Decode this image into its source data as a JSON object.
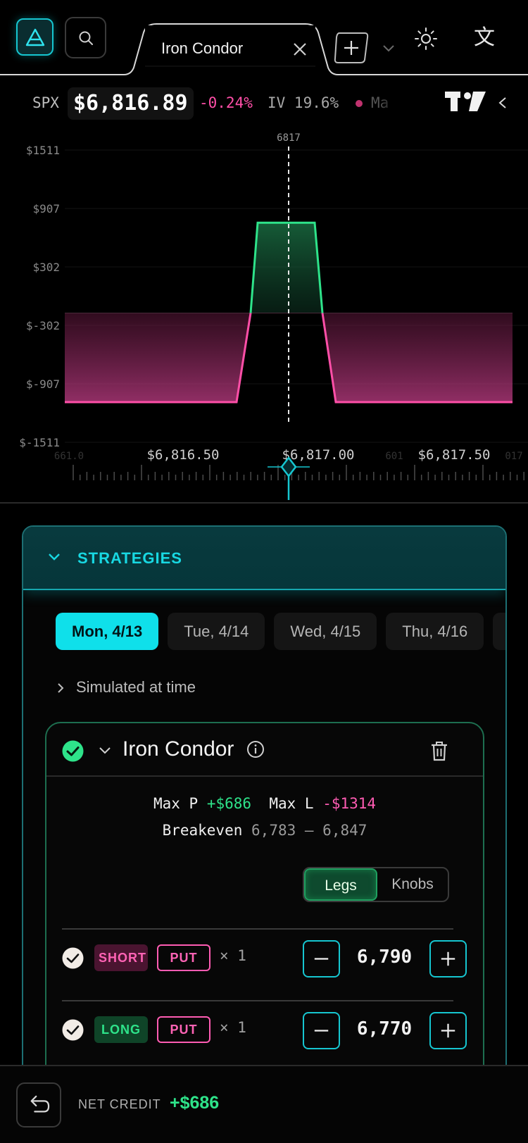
{
  "tab": {
    "title": "Iron Condor"
  },
  "ticker": {
    "symbol": "SPX",
    "price": "$6,816.89",
    "change": "-0.24%",
    "iv": "IV 19.6%",
    "ma": "Ma"
  },
  "chart": {
    "y_ticks": [
      "$1511",
      "$907",
      "$302",
      "$-302",
      "$-907",
      "$-1511"
    ],
    "x_ticks": [
      "$6,816.50",
      "$6,817.00",
      "$6,817.50"
    ],
    "x_faded": [
      "661.0",
      "601",
      "017"
    ],
    "marker_label": "6817"
  },
  "chart_data": {
    "type": "area",
    "title": "",
    "xlabel": "",
    "ylabel": "",
    "x_ticks": [
      "$6,816.50",
      "$6,817.00",
      "$6,817.50"
    ],
    "y_ticks": [
      1511,
      907,
      302,
      -302,
      -907,
      -1511
    ],
    "ylim": [
      -1511,
      1511
    ],
    "current_price": 6817,
    "payoff": {
      "max_profit": 686,
      "max_loss": -1314,
      "breakevens": [
        6783,
        6847
      ],
      "shape_points": [
        {
          "region": "left_tail",
          "pnl": -1314
        },
        {
          "region": "lower_ramp_start",
          "pnl": -1314
        },
        {
          "region": "plateau_left",
          "pnl": 686
        },
        {
          "region": "plateau_right",
          "pnl": 686
        },
        {
          "region": "upper_ramp_end",
          "pnl": -1314
        },
        {
          "region": "right_tail",
          "pnl": -1314
        }
      ]
    },
    "colors": {
      "profit": "#2ee38a",
      "loss": "#ff4fa8"
    }
  },
  "panel": {
    "title": "STRATEGIES",
    "dates": [
      "Mon, 4/13",
      "Tue, 4/14",
      "Wed, 4/15",
      "Thu, 4/16"
    ],
    "active_date": "Mon, 4/13",
    "simulated_label": "Simulated at time"
  },
  "strategy": {
    "name": "Iron Condor",
    "max_p_label": "Max P",
    "max_p": "+$686",
    "max_l_label": "Max L",
    "max_l": "-$1314",
    "breakeven_label": "Breakeven",
    "breakeven": "6,783 – 6,847",
    "toggle": {
      "legs": "Legs",
      "knobs": "Knobs",
      "active": "Legs"
    },
    "legs": [
      {
        "side": "SHORT",
        "type": "PUT",
        "qty": "× 1",
        "strike": "6,790",
        "minus": "−",
        "plus": "+"
      },
      {
        "side": "LONG",
        "type": "PUT",
        "qty": "× 1",
        "strike": "6,770",
        "minus": "−",
        "plus": "+"
      }
    ]
  },
  "footer": {
    "net_label": "NET CREDIT",
    "net_value": "+$686"
  },
  "colors": {
    "accent": "#16c6d0",
    "profit": "#2ee38a",
    "loss": "#ff4fa8"
  }
}
